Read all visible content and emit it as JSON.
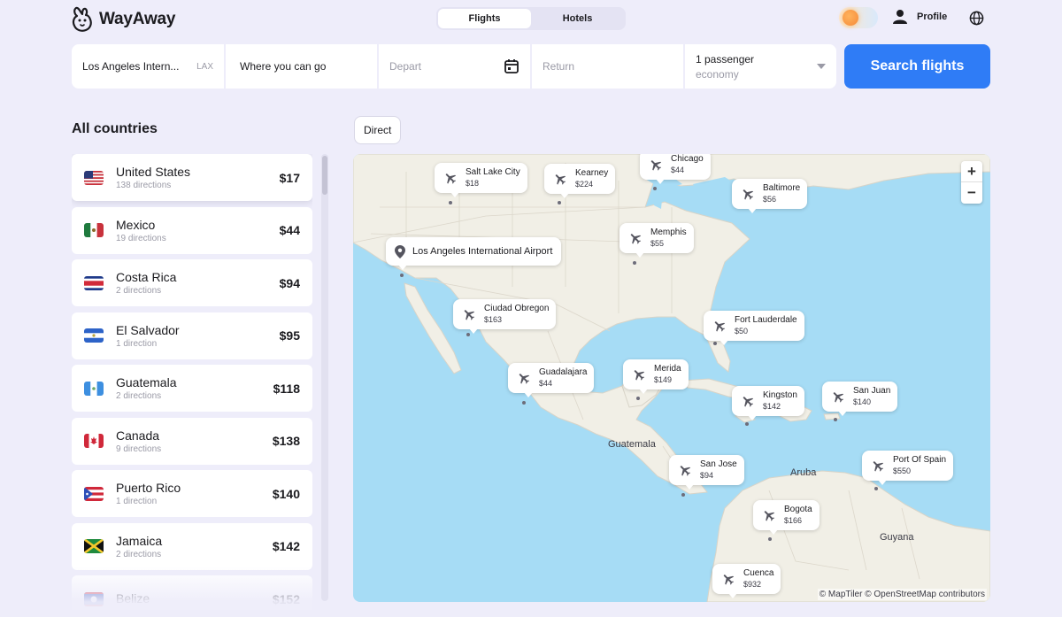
{
  "app": {
    "name": "WayAway"
  },
  "tabs": [
    {
      "label": "Flights",
      "active": true
    },
    {
      "label": "Hotels",
      "active": false
    }
  ],
  "header": {
    "profile_label": "Profile"
  },
  "search": {
    "origin": "Los Angeles Intern...",
    "origin_code": "LAX",
    "destination": "Where you can go",
    "depart_placeholder": "Depart",
    "return_placeholder": "Return",
    "passengers": "1 passenger",
    "cabin": "economy",
    "button_label": "Search flights"
  },
  "countries": {
    "title": "All countries",
    "items": [
      {
        "name": "United States",
        "directions": "138 directions",
        "price": "$17"
      },
      {
        "name": "Mexico",
        "directions": "19 directions",
        "price": "$44"
      },
      {
        "name": "Costa Rica",
        "directions": "2 directions",
        "price": "$94"
      },
      {
        "name": "El Salvador",
        "directions": "1 direction",
        "price": "$95"
      },
      {
        "name": "Guatemala",
        "directions": "2 directions",
        "price": "$118"
      },
      {
        "name": "Canada",
        "directions": "9 directions",
        "price": "$138"
      },
      {
        "name": "Puerto Rico",
        "directions": "1 direction",
        "price": "$140"
      },
      {
        "name": "Jamaica",
        "directions": "2 directions",
        "price": "$142"
      },
      {
        "name": "Belize",
        "directions": "",
        "price": "$152"
      }
    ]
  },
  "map": {
    "filter_chip": "Direct",
    "origin_airport": "Los Angeles International Airport",
    "destinations": [
      {
        "city": "Salt Lake City",
        "price": "$18"
      },
      {
        "city": "Kearney",
        "price": "$224"
      },
      {
        "city": "Chicago",
        "price": "$44"
      },
      {
        "city": "Baltimore",
        "price": "$56"
      },
      {
        "city": "Memphis",
        "price": "$55"
      },
      {
        "city": "Ciudad Obregon",
        "price": "$163"
      },
      {
        "city": "Fort Lauderdale",
        "price": "$50"
      },
      {
        "city": "Guadalajara",
        "price": "$44"
      },
      {
        "city": "Merida",
        "price": "$149"
      },
      {
        "city": "Kingston",
        "price": "$142"
      },
      {
        "city": "San Juan",
        "price": "$140"
      },
      {
        "city": "San Jose",
        "price": "$94"
      },
      {
        "city": "Port Of Spain",
        "price": "$550"
      },
      {
        "city": "Bogota",
        "price": "$166"
      },
      {
        "city": "Cuenca",
        "price": "$932"
      }
    ],
    "labels": {
      "guatemala": "Guatemala",
      "aruba": "Aruba",
      "guyana": "Guyana"
    },
    "zoom_in": "+",
    "zoom_out": "−",
    "attribution": "© MapTiler © OpenStreetMap contributors"
  },
  "colors": {
    "accent": "#2f7cf6",
    "background": "#eeedfa",
    "water": "#a6dcf5",
    "land": "#f1efe6"
  },
  "icons": {
    "logo": "rabbit-logo-icon",
    "calendar": "calendar-icon",
    "plane": "plane-icon",
    "location": "location-pin-icon",
    "globe": "globe-icon",
    "profile": "person-icon"
  }
}
